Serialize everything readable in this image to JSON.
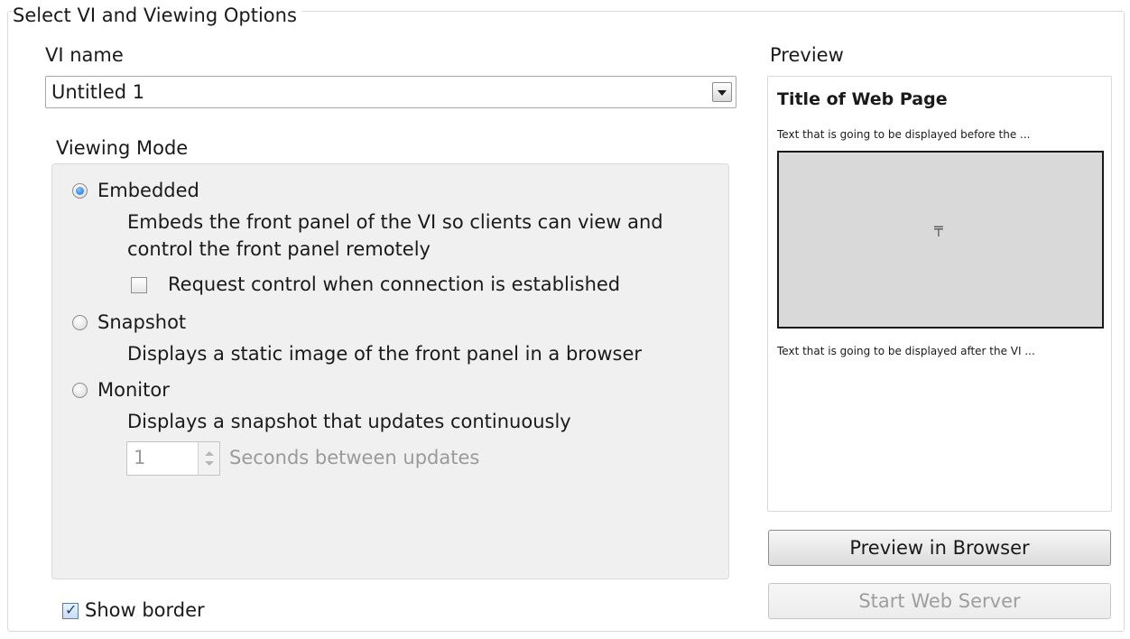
{
  "frame": {
    "title": "Select VI and Viewing Options"
  },
  "vi_name": {
    "label": "VI name",
    "selected": "Untitled 1"
  },
  "viewing_mode": {
    "label": "Viewing Mode",
    "embedded": {
      "label": "Embedded",
      "selected": true,
      "desc_line1": "Embeds the front panel of the VI so clients can view and",
      "desc_line2": "control the front panel remotely",
      "request_control": {
        "label": "Request control when connection is established",
        "checked": false
      }
    },
    "snapshot": {
      "label": "Snapshot",
      "selected": false,
      "desc": "Displays a static image of the front panel in a browser"
    },
    "monitor": {
      "label": "Monitor",
      "selected": false,
      "desc": "Displays a snapshot that updates continuously",
      "interval_value": "1",
      "interval_label": "Seconds between updates"
    }
  },
  "show_border": {
    "label": "Show border",
    "checked": true
  },
  "preview": {
    "label": "Preview",
    "page_title": "Title of Web Page",
    "text_before": "Text that is going to be displayed before the ...",
    "text_after": "Text that is going to be displayed after the VI ..."
  },
  "buttons": {
    "preview_in_browser": "Preview in Browser",
    "start_web_server": "Start Web Server"
  }
}
